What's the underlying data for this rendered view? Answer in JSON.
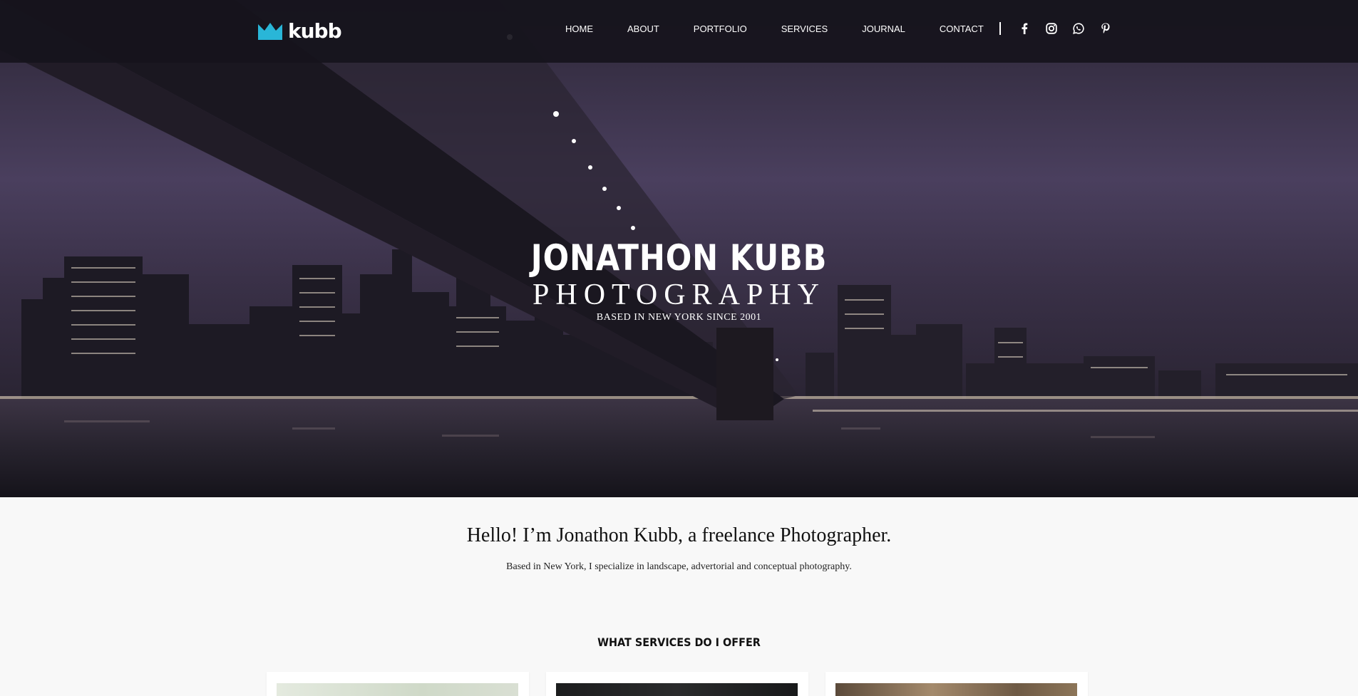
{
  "brand": {
    "logo_text": "kubb",
    "accent": "#29b6d8"
  },
  "nav": {
    "items": [
      {
        "label": "HOME"
      },
      {
        "label": "ABOUT"
      },
      {
        "label": "PORTFOLIO"
      },
      {
        "label": "SERVICES"
      },
      {
        "label": "JOURNAL"
      },
      {
        "label": "CONTACT"
      }
    ],
    "social_icons": [
      "facebook-icon",
      "instagram-icon",
      "whatsapp-icon",
      "pinterest-icon"
    ]
  },
  "hero": {
    "title": "JONATHON KUBB",
    "subtitle": "PHOTOGRAPHY",
    "tagline": "BASED IN NEW YORK SINCE 2001"
  },
  "intro": {
    "heading": "Hello! I’m Jonathon Kubb, a freelance Photographer.",
    "text": "Based in New York, I specialize in landscape, advertorial and conceptual photography."
  },
  "services": {
    "heading": "WHAT SERVICES DO I OFFER"
  }
}
